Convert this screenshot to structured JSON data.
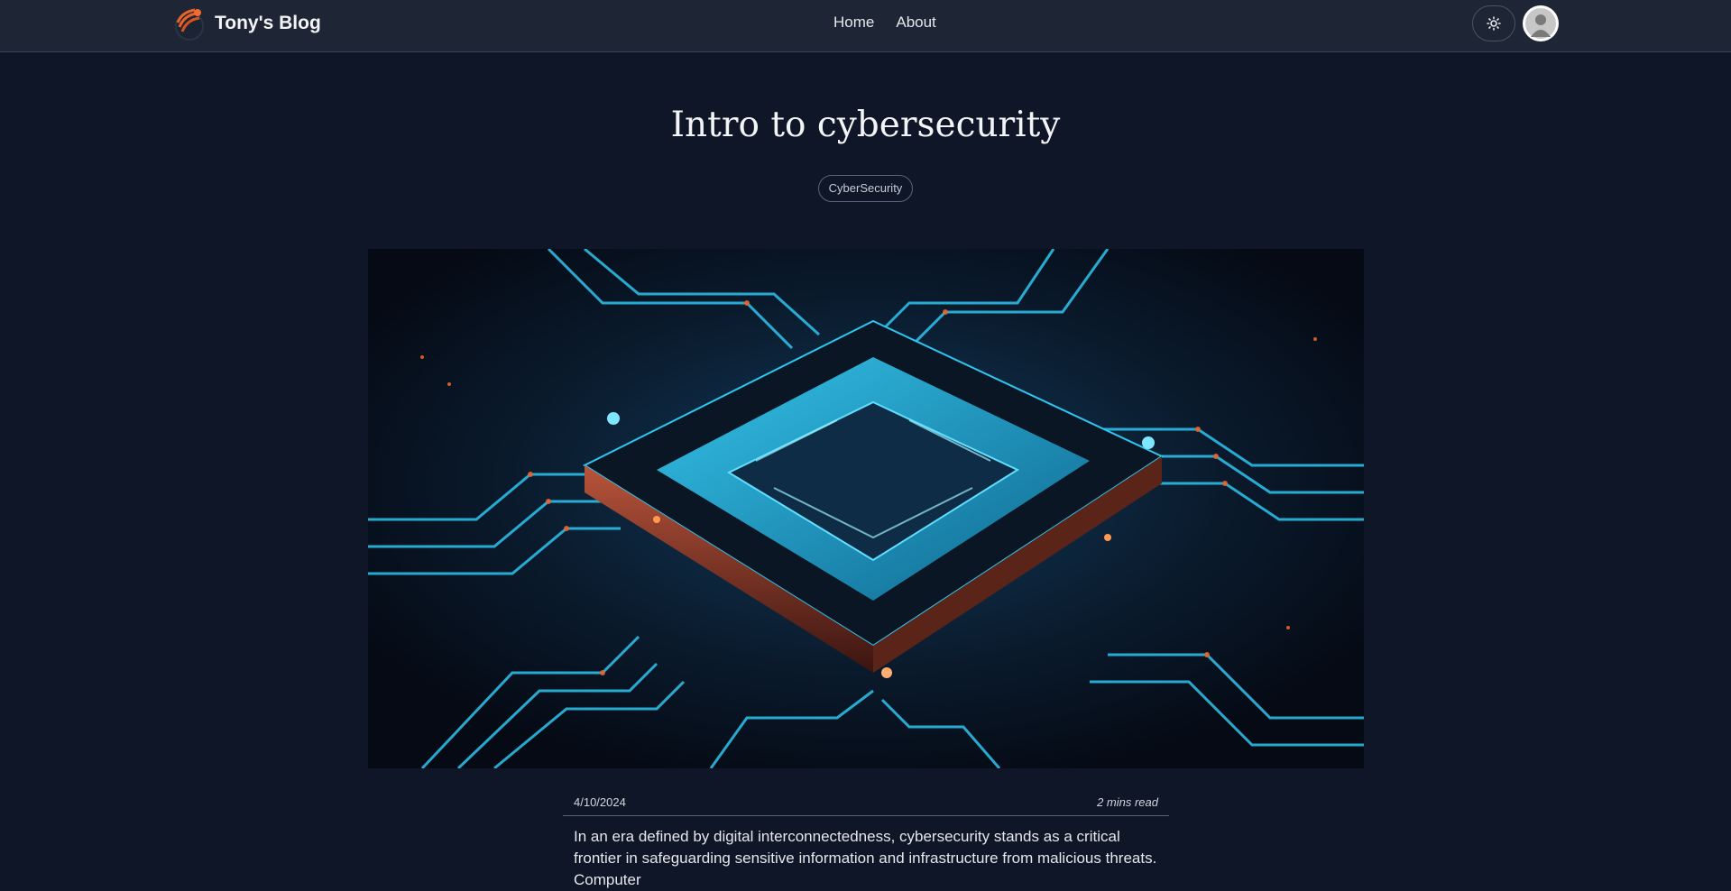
{
  "header": {
    "brand_name": "Tony's Blog",
    "nav": [
      {
        "label": "Home"
      },
      {
        "label": "About"
      }
    ],
    "theme_toggle_icon": "sun-icon",
    "avatar_icon": "user-avatar-icon"
  },
  "post": {
    "title": "Intro to cybersecurity",
    "tags": [
      "CyberSecurity"
    ],
    "hero_image_icon": "circuit-board-chip-image",
    "date": "4/10/2024",
    "read_time": "2 mins read",
    "body": "In an era defined by digital interconnectedness, cybersecurity stands as a critical frontier in safeguarding sensitive information and infrastructure from malicious threats. Computer"
  },
  "colors": {
    "page_bg": "#0f1628",
    "navbar_bg": "#1e2535",
    "text": "#e5e7eb",
    "accent_orange": "#e8622a",
    "circuit_cyan": "#2ec5f0"
  }
}
